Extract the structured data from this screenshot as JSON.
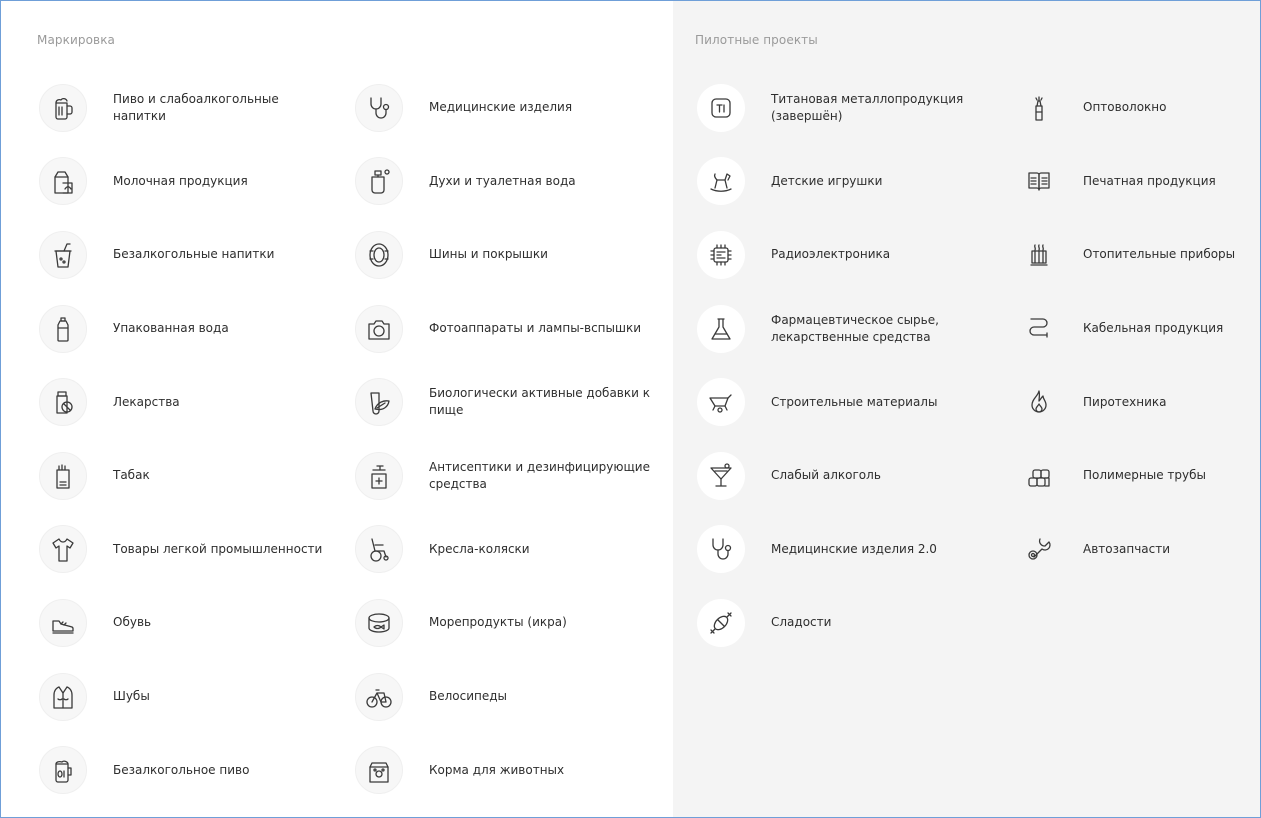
{
  "marking": {
    "title": "Маркировка",
    "col1": [
      {
        "label": "Пиво и слабоалкогольные напитки",
        "icon": "beer-mug-icon"
      },
      {
        "label": "Молочная продукция",
        "icon": "milk-carton-icon"
      },
      {
        "label": "Безалкогольные напитки",
        "icon": "soft-drink-cup-icon"
      },
      {
        "label": "Упакованная вода",
        "icon": "water-bottle-icon"
      },
      {
        "label": "Лекарства",
        "icon": "pill-bottle-icon"
      },
      {
        "label": "Табак",
        "icon": "cigarette-pack-icon"
      },
      {
        "label": "Товары легкой промышленности",
        "icon": "t-shirt-icon"
      },
      {
        "label": "Обувь",
        "icon": "shoe-icon"
      },
      {
        "label": "Шубы",
        "icon": "fur-coat-icon"
      },
      {
        "label": "Безалкогольное пиво",
        "icon": "zero-beer-icon"
      }
    ],
    "col2": [
      {
        "label": "Медицинские изделия",
        "icon": "stethoscope-icon"
      },
      {
        "label": "Духи и туалетная вода",
        "icon": "perfume-icon"
      },
      {
        "label": "Шины и покрышки",
        "icon": "tire-icon"
      },
      {
        "label": "Фотоаппараты и лампы-вспышки",
        "icon": "camera-icon"
      },
      {
        "label": "Биологически активные добавки к пище",
        "icon": "supplement-leaf-icon"
      },
      {
        "label": "Антисептики и дезинфицирующие средства",
        "icon": "sanitizer-pump-icon"
      },
      {
        "label": "Кресла-коляски",
        "icon": "wheelchair-icon"
      },
      {
        "label": "Морепродукты (икра)",
        "icon": "caviar-can-icon"
      },
      {
        "label": "Велосипеды",
        "icon": "bicycle-icon"
      },
      {
        "label": "Корма для животных",
        "icon": "pet-food-icon"
      }
    ]
  },
  "pilot": {
    "title": "Пилотные проекты",
    "col1": [
      {
        "label": "Титановая металлопродукция (завершён)",
        "icon": "titanium-icon"
      },
      {
        "label": "Детские игрушки",
        "icon": "rocking-horse-icon"
      },
      {
        "label": "Радиоэлектроника",
        "icon": "microchip-icon"
      },
      {
        "label": "Фармацевтическое сырье, лекарственные средства",
        "icon": "flask-icon"
      },
      {
        "label": "Строительные материалы",
        "icon": "wheelbarrow-icon"
      },
      {
        "label": "Слабый алкоголь",
        "icon": "cocktail-glass-icon"
      },
      {
        "label": "Медицинские изделия 2.0",
        "icon": "stethoscope-icon"
      },
      {
        "label": "Сладости",
        "icon": "candy-icon"
      }
    ],
    "col2": [
      {
        "label": "Оптоволокно",
        "icon": "fiber-optic-icon"
      },
      {
        "label": "Печатная продукция",
        "icon": "open-book-icon"
      },
      {
        "label": "Отопительные приборы",
        "icon": "radiator-icon"
      },
      {
        "label": "Кабельная продукция",
        "icon": "cable-icon"
      },
      {
        "label": "Пиротехника",
        "icon": "flame-icon"
      },
      {
        "label": "Полимерные трубы",
        "icon": "pipes-stack-icon"
      },
      {
        "label": "Автозапчасти",
        "icon": "wrench-gear-icon"
      }
    ]
  }
}
